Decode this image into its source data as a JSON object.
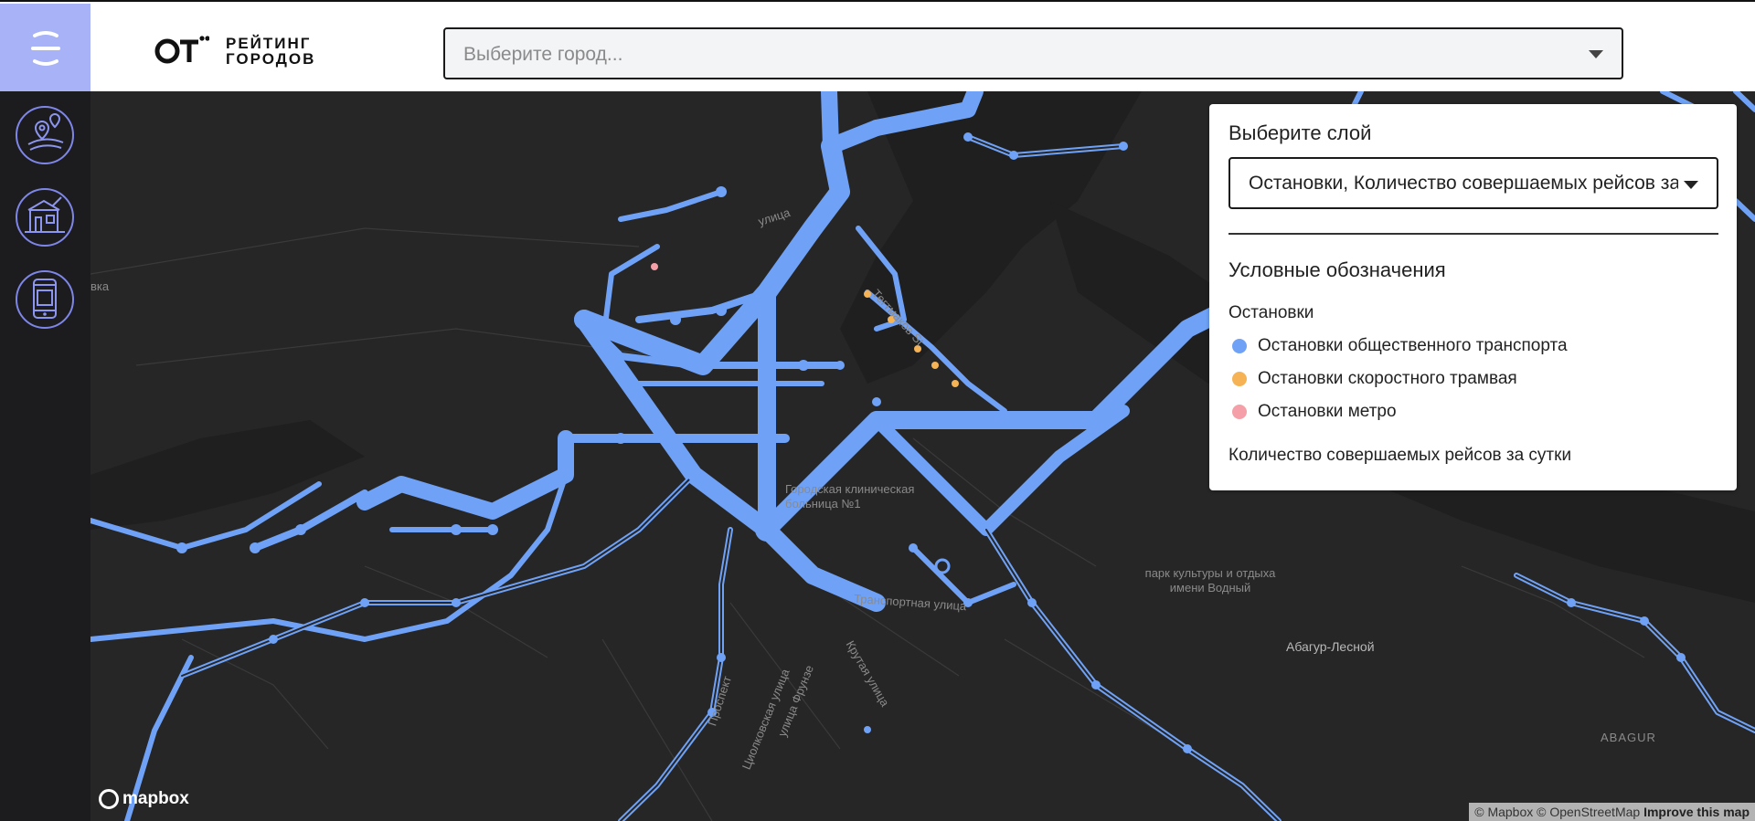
{
  "header": {
    "logo_text_line1": "РЕЙТИНГ",
    "logo_text_line2": "ГОРОДОВ",
    "city_select_placeholder": "Выберите город..."
  },
  "sidebar": {
    "items": [
      {
        "icon": "route-map-icon"
      },
      {
        "icon": "city-buildings-icon"
      },
      {
        "icon": "mobile-app-icon"
      }
    ]
  },
  "map": {
    "labels": {
      "hospital": "Городская клиническая больница №1",
      "street_1": "улица",
      "street_2": "Тегтмаков St",
      "street_transport": "Транспортная улица",
      "street_krutaya": "Крутая улица",
      "street_frunze": "улица Фрунзе",
      "street_tsiolkovskogo": "Циолковская улица",
      "street_prince": "Проспект",
      "park": "парк культуры и отдыха имени Водный",
      "abagur_lesnoy": "Абагур-Лесной",
      "abagur": "ABAGUR",
      "left_edge": "вка"
    }
  },
  "panel": {
    "layer_title": "Выберите слой",
    "layer_value": "Остановки, Количество совершаемых рейсов за сутки",
    "legend_title": "Условные обозначения",
    "legend_sub": "Остановки",
    "legend_items": [
      {
        "label": "Остановки общественного транспорта",
        "color": "#6fa2f7"
      },
      {
        "label": "Остановки скоростного трамвая",
        "color": "#f5b356"
      },
      {
        "label": "Остановки метро",
        "color": "#f5a0a8"
      }
    ],
    "trips_label": "Количество совершаемых рейсов за сутки"
  },
  "footer": {
    "mapbox_logo": "mapbox",
    "attribution_1": "© Mapbox",
    "attribution_2": "© OpenStreetMap",
    "improve": "Improve this map"
  },
  "colors": {
    "accent": "#a7b2f7",
    "route": "#6fa2f7",
    "map_bg": "#262626"
  }
}
